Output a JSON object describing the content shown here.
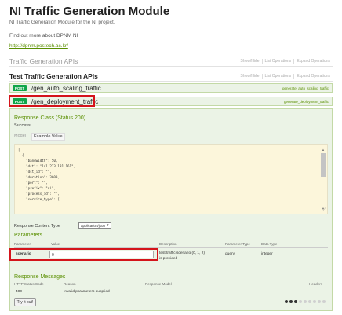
{
  "header": {
    "title": "NI Traffic Generation Module",
    "description": "NI Traffic Generation Module for the NI project.",
    "find_more": "Find out more about DPNM NI",
    "link": "http://dpnm.postech.ac.kr/"
  },
  "section_outer": {
    "title": "Traffic Generation APIs",
    "show_hide": "Show/Hide",
    "list_operations": "List Operations",
    "expand_operations": "Expand Operations"
  },
  "section_inner": {
    "title": "Test Traffic Generation APIs",
    "show_hide": "Show/Hide",
    "list_operations": "List Operations",
    "expand_operations": "Expand Operations"
  },
  "endpoints": [
    {
      "method": "POST",
      "path": "/gen_auto_scaling_traffic",
      "operation": "generate_auto_scaling_traffic"
    },
    {
      "method": "POST",
      "path": "/gen_deployment_traffic",
      "operation": "generate_deployment_traffic"
    }
  ],
  "response_class": {
    "title": "Response Class (Status 200)",
    "status_text": "Success.",
    "tab_model": "Model",
    "tab_example": "Example Value",
    "example_json": "[\n  {\n    \"bandwidth\": 50,\n    \"dst\": \"141.223.181.161\",\n    \"dst_id\": \"\",\n    \"duration\": 3600,\n    \"port\": \"\",\n    \"prefix\": \"ni\",\n    \"process_id\": \"\",\n    \"service_type\": ["
  },
  "content_type": {
    "label": "Response Content Type",
    "selected": "application/json"
  },
  "parameters": {
    "title": "Parameters",
    "headers": [
      "Parameter",
      "Value",
      "Description",
      "Parameter Type",
      "Data Type"
    ],
    "row": {
      "name": "scenario",
      "value": "0",
      "description_line1": "test traffic scenario (0, 1, 2)",
      "description_line2": "is provided",
      "param_type": "query",
      "data_type": "integer"
    }
  },
  "response_messages": {
    "title": "Response Messages",
    "headers": [
      "HTTP Status Code",
      "Reason",
      "Response Model",
      "Headers"
    ],
    "row": {
      "code": "400",
      "reason": "Invalid parameters supplied"
    }
  },
  "try_button": "Try it out!",
  "colors": {
    "accent_green": "#10a54a",
    "highlight_red": "#d4141b",
    "panel_bg": "#ebf3e6"
  }
}
